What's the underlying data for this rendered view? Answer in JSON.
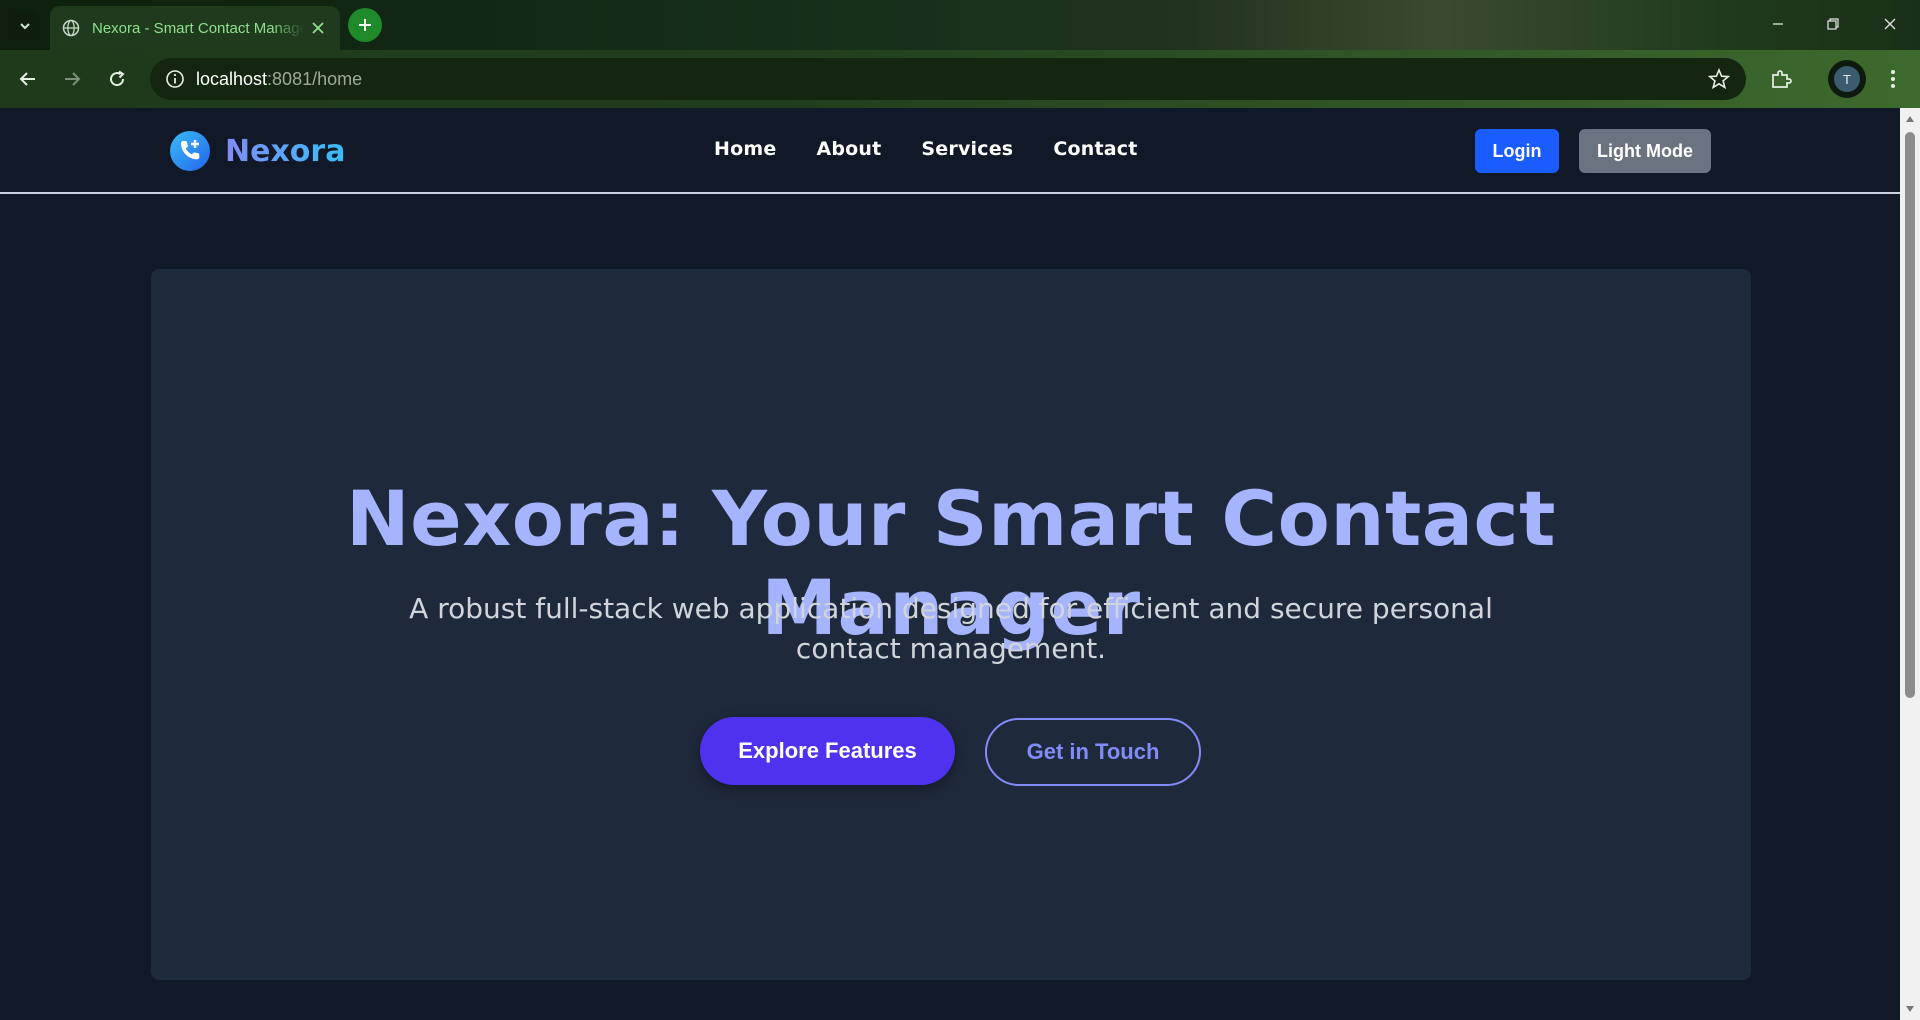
{
  "browser": {
    "tab_title": "Nexora - Smart Contact Manager",
    "url_host": "localhost",
    "url_rest": ":8081/home",
    "profile_initial": "T"
  },
  "site": {
    "brand": "Nexora",
    "nav": [
      "Home",
      "About",
      "Services",
      "Contact"
    ],
    "login_label": "Login",
    "mode_label": "Light Mode"
  },
  "hero": {
    "title": "Nexora: Your Smart Contact Manager",
    "subtitle": "A robust full-stack web application designed for efficient and secure personal contact management.",
    "primary_cta": "Explore Features",
    "secondary_cta": "Get in Touch"
  },
  "colors": {
    "background": "#111827",
    "card": "#1e293b",
    "accent": "#a5b4fc",
    "primary_button": "#4f32f0",
    "login_button": "#1a5cff"
  }
}
